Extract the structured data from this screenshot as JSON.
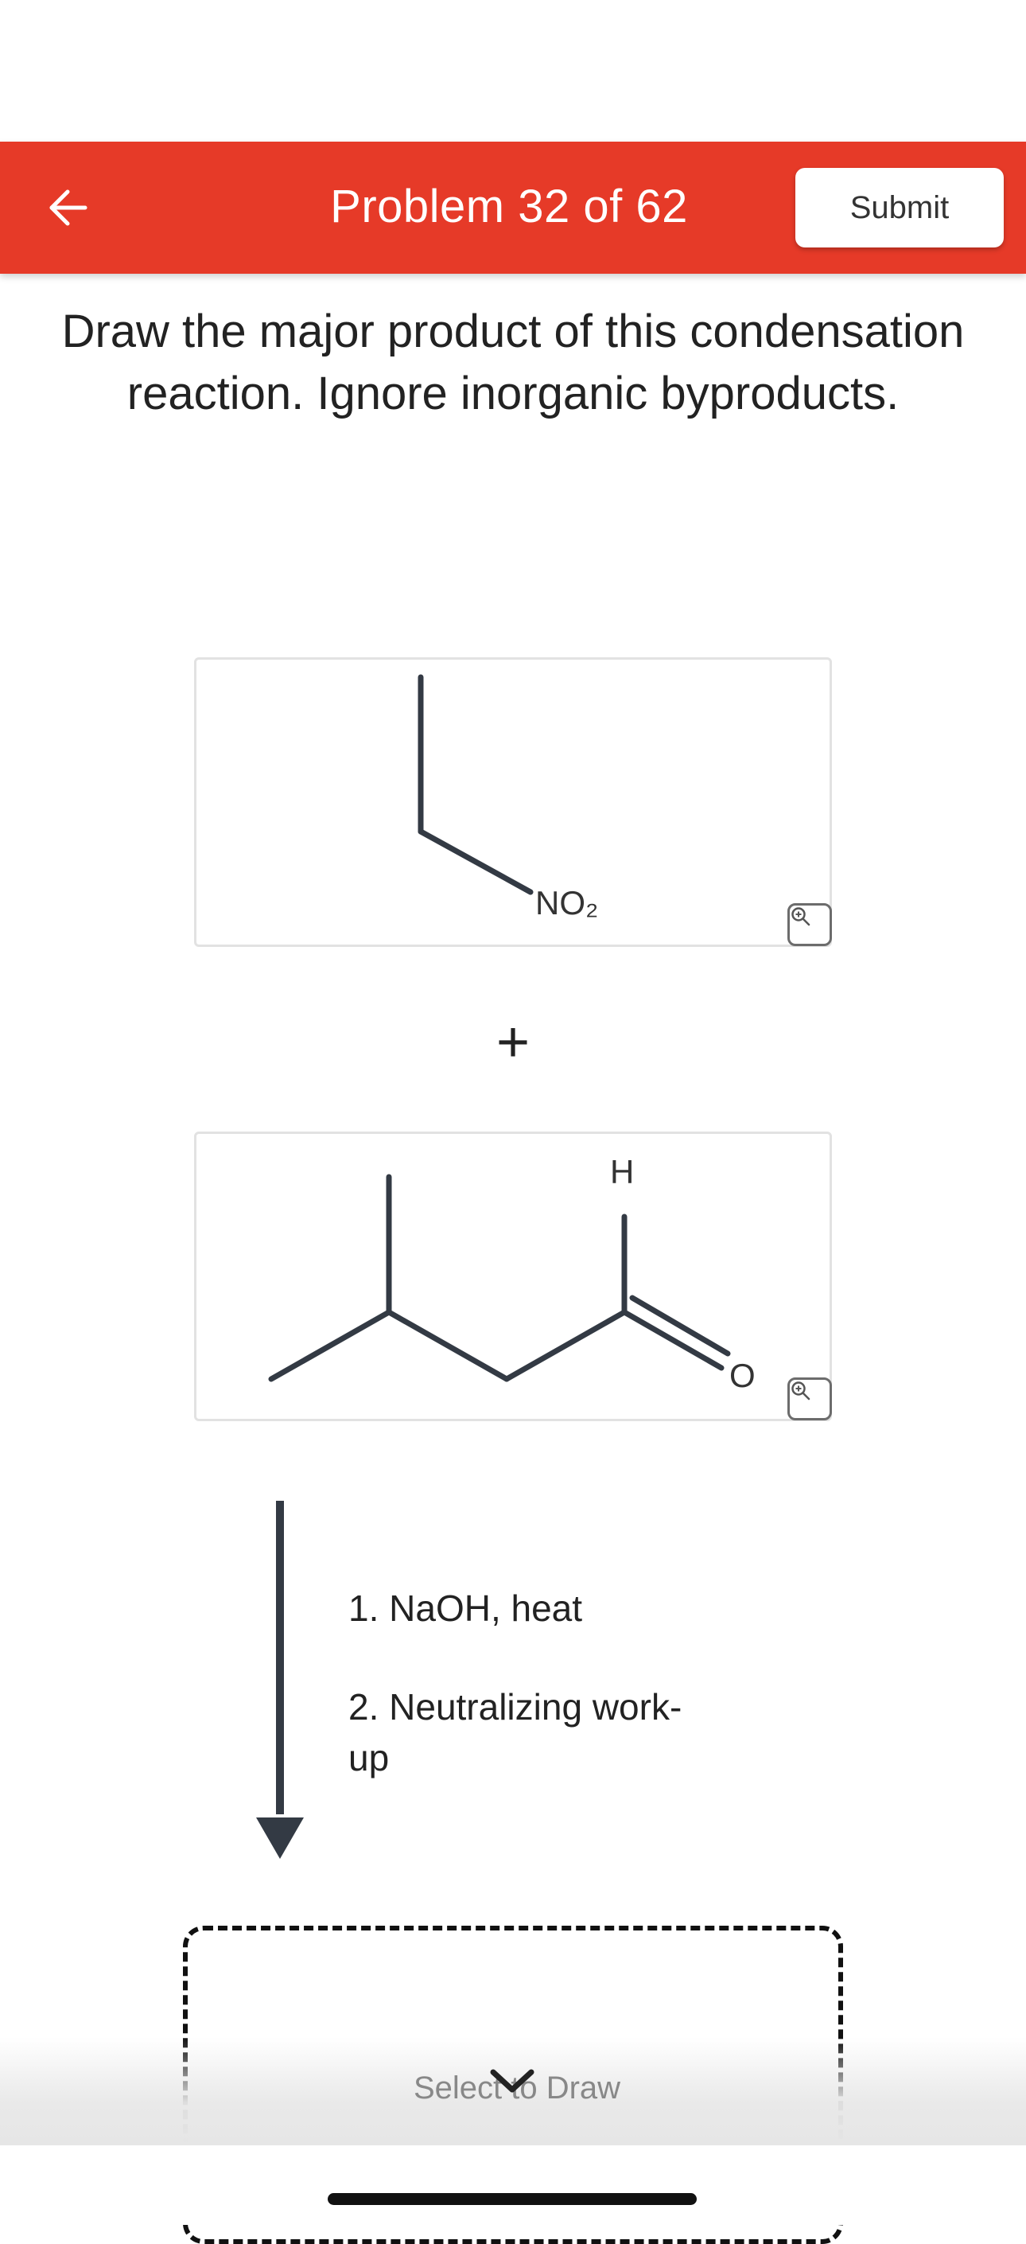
{
  "header": {
    "title": "Problem 32 of 62",
    "submit_label": "Submit",
    "back_icon": "arrow-left-icon",
    "background_color": "#e63a28"
  },
  "question": {
    "text": "Draw the major product of this condensation reaction. Ignore inorganic byproducts."
  },
  "reactant1": {
    "label_no2": "NO₂",
    "zoom_icon": "zoom-in-icon"
  },
  "plus_sign": "+",
  "reactant2": {
    "label_h": "H",
    "label_o": "O",
    "zoom_icon": "zoom-in-icon"
  },
  "conditions": {
    "step1": "1. NaOH, heat",
    "step2_line1": "2. Neutralizing work-",
    "step2_line2": "up"
  },
  "answer": {
    "select_label": "Select to Draw",
    "chevron_icon": "chevron-down-icon"
  }
}
